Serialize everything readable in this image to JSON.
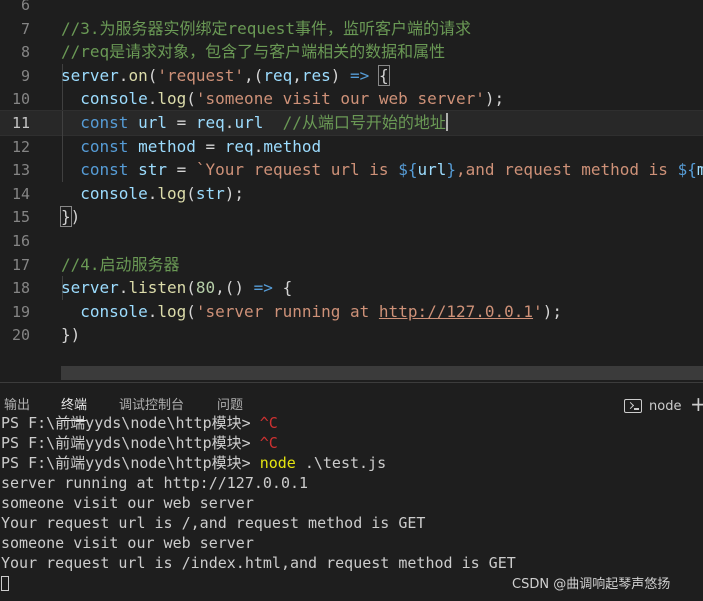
{
  "editor": {
    "lines": [
      {
        "num": "6",
        "tokens": []
      },
      {
        "num": "7",
        "tokens": [
          {
            "t": "//3.为服务器实例绑定request事件，监听客户端的请求",
            "c": "comment"
          }
        ]
      },
      {
        "num": "8",
        "tokens": [
          {
            "t": "//req是请求对象，包含了与客户端相关的数据和属性",
            "c": "comment"
          }
        ]
      },
      {
        "num": "9",
        "tokens": [
          {
            "t": "server",
            "c": "var"
          },
          {
            "t": ".",
            "c": "punc"
          },
          {
            "t": "on",
            "c": "fn"
          },
          {
            "t": "(",
            "c": "punc"
          },
          {
            "t": "'request'",
            "c": "str"
          },
          {
            "t": ",(",
            "c": "punc"
          },
          {
            "t": "req",
            "c": "var"
          },
          {
            "t": ",",
            "c": "punc"
          },
          {
            "t": "res",
            "c": "var"
          },
          {
            "t": ") ",
            "c": "punc"
          },
          {
            "t": "=>",
            "c": "kw"
          },
          {
            "t": " ",
            "c": "punc"
          },
          {
            "t": "{",
            "c": "match"
          }
        ]
      },
      {
        "num": "10",
        "tokens": [
          {
            "t": "  console",
            "c": "var"
          },
          {
            "t": ".",
            "c": "punc"
          },
          {
            "t": "log",
            "c": "fn"
          },
          {
            "t": "(",
            "c": "punc"
          },
          {
            "t": "'someone visit our web server'",
            "c": "str"
          },
          {
            "t": ");",
            "c": "punc"
          }
        ]
      },
      {
        "num": "11",
        "current": true,
        "tokens": [
          {
            "t": "  const",
            "c": "kw"
          },
          {
            "t": " ",
            "c": "punc"
          },
          {
            "t": "url",
            "c": "var"
          },
          {
            "t": " = ",
            "c": "punc"
          },
          {
            "t": "req",
            "c": "var"
          },
          {
            "t": ".",
            "c": "punc"
          },
          {
            "t": "url",
            "c": "var"
          },
          {
            "t": "  ",
            "c": "punc"
          },
          {
            "t": "//从端口号开始的地址",
            "c": "comment"
          },
          {
            "t": "",
            "c": "cursor"
          }
        ]
      },
      {
        "num": "12",
        "tokens": [
          {
            "t": "  const",
            "c": "kw"
          },
          {
            "t": " ",
            "c": "punc"
          },
          {
            "t": "method",
            "c": "var"
          },
          {
            "t": " = ",
            "c": "punc"
          },
          {
            "t": "req",
            "c": "var"
          },
          {
            "t": ".",
            "c": "punc"
          },
          {
            "t": "method",
            "c": "var"
          }
        ]
      },
      {
        "num": "13",
        "tokens": [
          {
            "t": "  const",
            "c": "kw"
          },
          {
            "t": " ",
            "c": "punc"
          },
          {
            "t": "str",
            "c": "var"
          },
          {
            "t": " = ",
            "c": "punc"
          },
          {
            "t": "`Your request url is ",
            "c": "str"
          },
          {
            "t": "${",
            "c": "kw"
          },
          {
            "t": "url",
            "c": "var"
          },
          {
            "t": "}",
            "c": "kw"
          },
          {
            "t": ",and request method is ",
            "c": "str"
          },
          {
            "t": "${",
            "c": "kw"
          },
          {
            "t": "m",
            "c": "var"
          }
        ]
      },
      {
        "num": "14",
        "tokens": [
          {
            "t": "  console",
            "c": "var"
          },
          {
            "t": ".",
            "c": "punc"
          },
          {
            "t": "log",
            "c": "fn"
          },
          {
            "t": "(",
            "c": "punc"
          },
          {
            "t": "str",
            "c": "var"
          },
          {
            "t": ");",
            "c": "punc"
          }
        ]
      },
      {
        "num": "15",
        "tokens": [
          {
            "t": "}",
            "c": "match"
          },
          {
            "t": ")",
            "c": "punc"
          }
        ]
      },
      {
        "num": "16",
        "tokens": []
      },
      {
        "num": "17",
        "tokens": [
          {
            "t": "//4.启动服务器",
            "c": "comment"
          }
        ]
      },
      {
        "num": "18",
        "tokens": [
          {
            "t": "server",
            "c": "var"
          },
          {
            "t": ".",
            "c": "punc"
          },
          {
            "t": "listen",
            "c": "fn"
          },
          {
            "t": "(",
            "c": "punc"
          },
          {
            "t": "80",
            "c": "num"
          },
          {
            "t": ",() ",
            "c": "punc"
          },
          {
            "t": "=>",
            "c": "kw"
          },
          {
            "t": " {",
            "c": "punc"
          }
        ]
      },
      {
        "num": "19",
        "tokens": [
          {
            "t": "  console",
            "c": "var"
          },
          {
            "t": ".",
            "c": "punc"
          },
          {
            "t": "log",
            "c": "fn"
          },
          {
            "t": "(",
            "c": "punc"
          },
          {
            "t": "'server running at ",
            "c": "str"
          },
          {
            "t": "http://127.0.0.1",
            "c": "url"
          },
          {
            "t": "'",
            "c": "str"
          },
          {
            "t": ");",
            "c": "punc"
          }
        ]
      },
      {
        "num": "20",
        "tokens": [
          {
            "t": "})",
            "c": "punc"
          }
        ]
      }
    ]
  },
  "panel": {
    "tabs": [
      {
        "label": "输出",
        "active": false
      },
      {
        "label": "终端",
        "active": true
      },
      {
        "label": "调试控制台",
        "active": false
      },
      {
        "label": "问题",
        "active": false
      }
    ],
    "terminal_name": "node",
    "add_label": "+"
  },
  "terminal": {
    "lines": [
      [
        {
          "t": "PS F:\\前端yyds\\node\\http模块> ",
          "c": "plain"
        },
        {
          "t": "^C",
          "c": "ctrl"
        }
      ],
      [
        {
          "t": "PS F:\\前端yyds\\node\\http模块> ",
          "c": "plain"
        },
        {
          "t": "^C",
          "c": "ctrl"
        }
      ],
      [
        {
          "t": "PS F:\\前端yyds\\node\\http模块> ",
          "c": "plain"
        },
        {
          "t": "node",
          "c": "cmd"
        },
        {
          "t": " .\\test.js",
          "c": "plain"
        }
      ],
      [
        {
          "t": "server running at http://127.0.0.1",
          "c": "plain"
        }
      ],
      [
        {
          "t": "someone visit our web server",
          "c": "plain"
        }
      ],
      [
        {
          "t": "Your request url is /,and request method is GET",
          "c": "plain"
        }
      ],
      [
        {
          "t": "someone visit our web server",
          "c": "plain"
        }
      ],
      [
        {
          "t": "Your request url is /index.html,and request method is GET",
          "c": "plain"
        }
      ],
      [
        {
          "t": "",
          "c": "caret"
        }
      ]
    ]
  },
  "watermark": "CSDN @曲调响起琴声悠扬"
}
